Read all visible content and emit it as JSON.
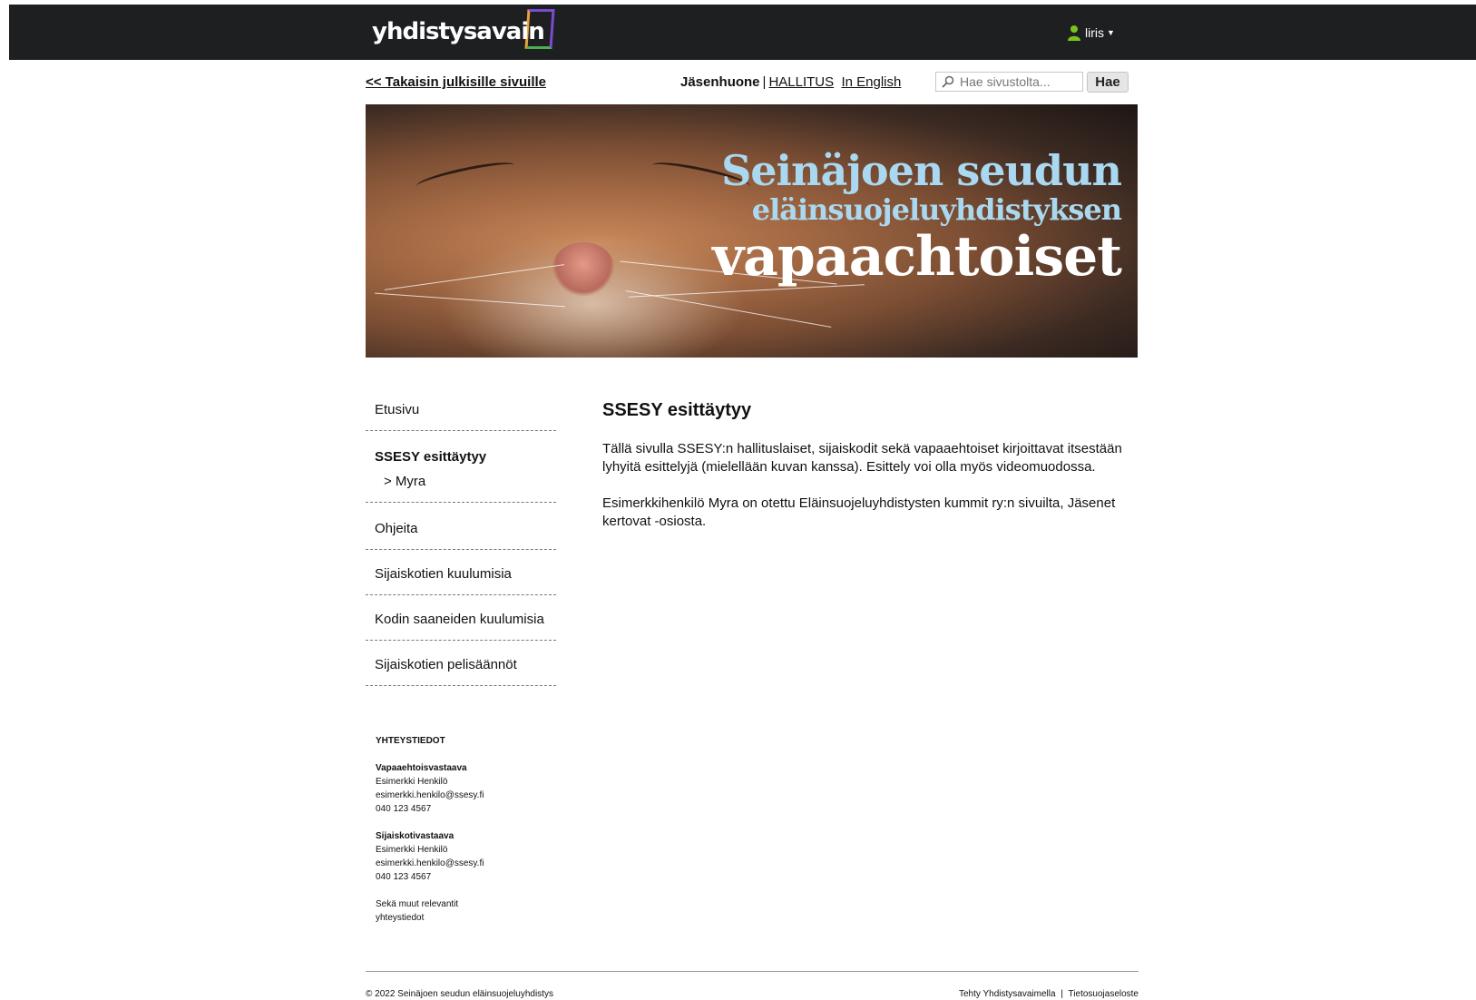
{
  "header": {
    "logo_text": "yhdistysavain",
    "user_name": "liris"
  },
  "topnav": {
    "back_link": "<< Takaisin julkisille sivuille",
    "current": "Jäsenhuone",
    "separator": "|",
    "hallitus": "HALLITUS",
    "english": "In English",
    "search_placeholder": "Hae sivustolta...",
    "search_button": "Hae"
  },
  "banner": {
    "line1": "Seinäjoen seudun",
    "line2": "eläinsuojeluyhdistyksen",
    "line3": "vapaachtoiset"
  },
  "sidebar": {
    "items": [
      {
        "label": "Etusivu"
      },
      {
        "label": "SSESY esittäytyy",
        "sub": "> Myra"
      },
      {
        "label": "Ohjeita"
      },
      {
        "label": "Sijaiskotien kuulumisia"
      },
      {
        "label": "Kodin saaneiden kuulumisia"
      },
      {
        "label": "Sijaiskotien pelisäännöt"
      }
    ]
  },
  "contact": {
    "title": "YHTEYSTIEDOT",
    "blocks": [
      {
        "role": "Vapaaehtoisvastaava",
        "name": "Esimerkki Henkilö",
        "email": "esimerkki.henkilo@ssesy.fi",
        "phone": "040 123 4567"
      },
      {
        "role": "Sijaiskotivastaava",
        "name": "Esimerkki Henkilö",
        "email": "esimerkki.henkilo@ssesy.fi",
        "phone": "040 123 4567"
      }
    ],
    "other_line1": "Sekä muut relevantit",
    "other_line2": "yhteystiedot"
  },
  "main": {
    "title": "SSESY esittäytyy",
    "para1": "Tällä sivulla SSESY:n hallituslaiset, sijaiskodit sekä vapaaehtoiset kirjoittavat itsestään lyhyitä esittelyjä (mielellään kuvan kanssa). Esittely voi olla myös videomuodossa.",
    "para2": "Esimerkkihenkilö Myra on otettu Eläinsuojeluyhdistysten kummit ry:n sivuilta, Jäsenet kertovat -osiosta."
  },
  "footer": {
    "copyright": "© 2022 Seinäjoen seudun eläinsuojeluyhdistys",
    "made_with": "Tehty Yhdistysavaimella",
    "separator": "|",
    "privacy": "Tietosuojaseloste"
  }
}
